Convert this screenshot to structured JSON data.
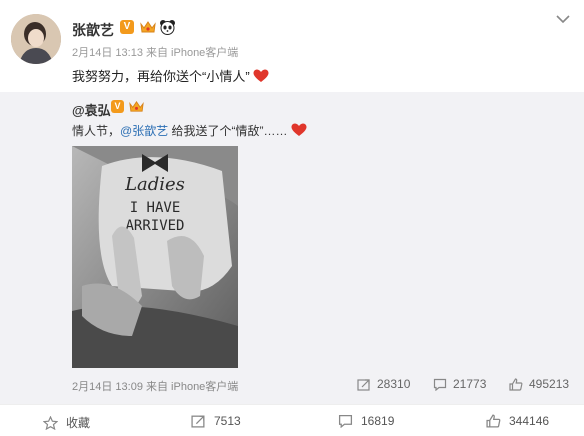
{
  "post": {
    "author": "张歆艺",
    "v_badge": "V",
    "timestamp": "2月14日 13:13 来自 iPhone客户端",
    "text": "我努努力，再给你送个“小情人”"
  },
  "repost": {
    "author": "@袁弘",
    "v_badge": "V",
    "text_before": "情人节，",
    "mention": "@张歆艺",
    "text_after": " 给我送了个“情敌”……",
    "timestamp": "2月14日 13:09 来自 iPhone客户端",
    "stats": {
      "reposts": "28310",
      "comments": "21773",
      "likes": "495213"
    },
    "photo_text": [
      "Ladies",
      "I HAVE",
      "ARRIVED"
    ]
  },
  "actions": {
    "favorite": "收藏",
    "reposts": "7513",
    "comments": "16819",
    "likes": "344146"
  },
  "colors": {
    "accent_orange": "#f39a1c",
    "link_blue": "#2c6fb4",
    "heart_red": "#e0362b",
    "repost_bg": "#f2f2f5"
  }
}
